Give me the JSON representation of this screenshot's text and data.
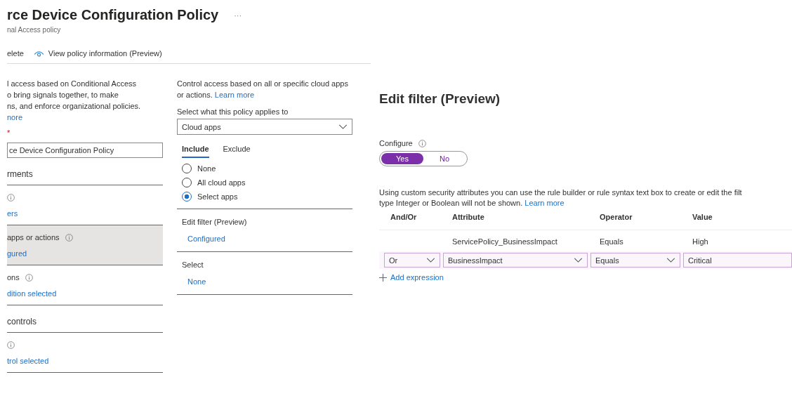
{
  "header": {
    "title": "rce Device Configuration Policy",
    "more": "···",
    "subtitle": "nal Access policy"
  },
  "toolbar": [
    {
      "label": "elete",
      "kind": "text"
    },
    {
      "label": "View policy information (Preview)",
      "kind": "eye"
    }
  ],
  "left": {
    "description": [
      "l access based on Conditional Access",
      "o bring signals together, to make",
      "ns, and enforce organizational policies."
    ],
    "link": "nore",
    "required_mark": "*",
    "name_value": "ce Device Configuration Policy",
    "sections": [
      {
        "title": "rments",
        "items": [
          {
            "value": "ers",
            "selected": false
          },
          {
            "label": "apps or actions",
            "value": "gured",
            "selected": true
          },
          {
            "label": "ons",
            "value": "dition selected",
            "selected": false
          }
        ]
      },
      {
        "title": "controls",
        "items": [
          {
            "value": "trol selected",
            "selected": false
          }
        ]
      }
    ]
  },
  "middle": {
    "description": "Control access based on all or specific cloud apps or actions.",
    "link": "Learn more",
    "applies_label": "Select what this policy applies to",
    "applies_value": "Cloud apps",
    "tabs": [
      {
        "label": "Include",
        "selected": true
      },
      {
        "label": "Exclude",
        "selected": false
      }
    ],
    "options": [
      {
        "label": "None",
        "selected": false
      },
      {
        "label": "All cloud apps",
        "selected": false
      },
      {
        "label": "Select apps",
        "selected": true
      }
    ],
    "sections": [
      {
        "title": "Edit filter (Preview)",
        "value": "Configured"
      },
      {
        "title": "Select",
        "value": "None"
      }
    ]
  },
  "filter": {
    "title": "Edit filter (Preview)",
    "configure_label": "Configure",
    "toggle": [
      {
        "label": "Yes",
        "selected": true
      },
      {
        "label": "No",
        "selected": false
      }
    ],
    "info_lines": [
      "Using custom security attributes you can use the rule builder or rule syntax text box to create or edit the filt",
      "type Integer or Boolean will not be shown."
    ],
    "info_link": "Learn more",
    "columns": [
      "And/Or",
      "Attribute",
      "Operator",
      "Value"
    ],
    "rows": [
      {
        "kind": "static",
        "cells": [
          {
            "kind": "empty"
          },
          {
            "kind": "text",
            "value": "ServicePolicy_BusinessImpact"
          },
          {
            "kind": "text",
            "value": "Equals"
          },
          {
            "kind": "text",
            "value": "High"
          }
        ]
      },
      {
        "kind": "edit",
        "cells": [
          {
            "kind": "dropdown",
            "value": "Or"
          },
          {
            "kind": "dropdown",
            "value": "BusinessImpact"
          },
          {
            "kind": "dropdown",
            "value": "Equals"
          },
          {
            "kind": "input",
            "value": "Critical"
          }
        ]
      }
    ],
    "add_expression": "Add expression"
  }
}
